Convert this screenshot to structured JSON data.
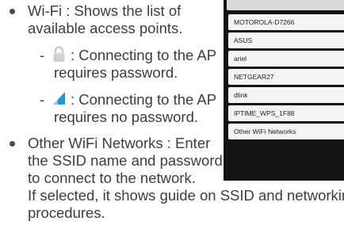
{
  "doc": {
    "wifi_bullet": [
      "Wi-Fi : Shows the list of",
      "available access points."
    ],
    "secured_item": [
      ": Connecting to the AP",
      "requires password."
    ],
    "open_item": [
      ": Connecting to the AP",
      "requires no password."
    ],
    "other_bullet": [
      "Other WiFi Networks : Enter",
      "the SSID name and password",
      "to connect to the network.",
      "If selected, it shows guide on SSID and networking",
      "procedures."
    ],
    "dash": "-"
  },
  "phone": {
    "access_points": [
      "MOTOROLA-D7266",
      "ASUS",
      "ariel",
      "NETGEAR27",
      "dlink",
      "IPTIME_WPS_1F88",
      "Other WiFi Networks"
    ]
  },
  "icons": {
    "lock": "lock-icon",
    "wifi": "wifi-icon"
  },
  "colors": {
    "text": "#3d3d3d",
    "phone_bg": "#141414",
    "row_bg": "#f4f4f4",
    "wifi_blue": "#1a9bd7"
  }
}
